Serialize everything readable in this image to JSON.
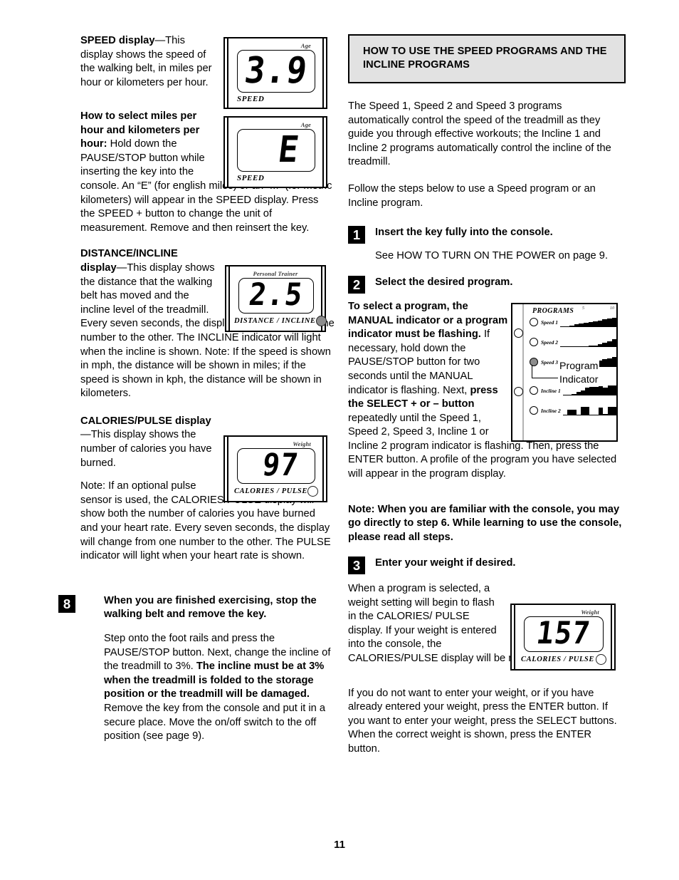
{
  "page": {
    "number": "11"
  },
  "left_column": {
    "speed_section": {
      "lead_bold": "SPEED display",
      "lead_rest": "—This display shows the speed of the walking belt, in miles per hour or kilometers per hour."
    },
    "units_section": {
      "lead_bold": "How to select miles per hour and kilometers per hour:",
      "lead_rest": " Hold down the PAUSE/STOP button while inserting the key into the console. An “E” (for english miles) or an “M” (for metric kilometers) will appear in the SPEED display. Press the SPEED + button to change the unit of measurement. Remove and then reinsert the key."
    },
    "distance_section": {
      "lead_bold": "DISTANCE/INCLINE display",
      "lead_rest": "—This display shows the distance that the walking belt has moved and the incline level of the treadmill. Every seven seconds, the display will change from one number to the other. The INCLINE indicator will light when the incline is shown. Note: If the speed is shown in mph, the distance will be shown in miles; if the speed is shown in kph, the distance will be shown in kilometers."
    },
    "calories_section": {
      "lead_bold": "CALORIES/PULSE display",
      "lead_rest": "—This display shows the number of calories you have burned."
    },
    "calories_note": "Note: If an optional pulse sensor is used, the CALORIES/PULSE display will show both the number of calories you have burned and your heart rate. Every seven seconds, the display will change from one number to the other. The PULSE indicator will light when your heart rate is shown.",
    "step8": {
      "number": "8",
      "title": "When you are finished exercising, stop the walking belt and remove the key.",
      "body_part1": "Step onto the foot rails and press the PAUSE/STOP button. Next, change the incline of the treadmill to 3%. ",
      "body_bold": "The incline must be at 3% when the treadmill is folded to the storage position or the treadmill will be damaged.",
      "body_part2": " Remove the key from the console and put it in a secure place. Move the on/off switch to the off position (see page 9)."
    },
    "displays": {
      "speed": {
        "top_label": "Age",
        "value": "3.9",
        "bottom_label": "SPEED"
      },
      "speed_units": {
        "top_label": "Age",
        "value": "E",
        "bottom_label": "SPEED"
      },
      "distance": {
        "top_label": "Personal Trainer",
        "value": "2.5",
        "bottom_label": "DISTANCE / INCLINE",
        "indicator": "filled-dot-icon"
      },
      "calories": {
        "top_label": "Weight",
        "value": "97",
        "bottom_label": "CALORIES / PULSE",
        "indicator": "open-dot-icon"
      }
    }
  },
  "right_column": {
    "heading": "HOW TO USE THE SPEED PROGRAMS AND THE INCLINE PROGRAMS",
    "intro_1": "The Speed 1, Speed 2 and Speed 3 programs automatically control the speed of the treadmill as they guide you through effective workouts; the Incline 1 and Incline 2 programs automatically control the incline of the treadmill.",
    "intro_2": "Follow the steps below to use a Speed program or an Incline program.",
    "step1": {
      "number": "1",
      "title": "Insert the key fully into the console.",
      "body": "See HOW TO TURN ON THE POWER on page 9."
    },
    "step2": {
      "number": "2",
      "title": "Select the desired program.",
      "body_bold_1": "To select a program, the MANUAL indicator or a program indicator must be flashing.",
      "body_plain_1": " If necessary, hold down the PAUSE/STOP button for two seconds until the MANUAL indicator is flashing. Next, ",
      "body_bold_2": "press the SELECT + or – button",
      "body_plain_2": " repeatedly until the Speed 1, Speed 2, Speed 3, Incline 1 or Incline 2 program indicator is flashing. Then, press the ENTER button. A profile of the program you have selected will appear in the program display.",
      "note": "Note: When you are familiar with the console, you may go directly to step 6. While learning to use the console, please read all steps."
    },
    "step3": {
      "number": "3",
      "title": "Enter your weight if desired.",
      "body_1": "When a program is selected, a weight setting will begin to flash in the CALORIES/ PULSE display. If your weight is entered into the console, the CALORIES/PULSE display will be more accurate.",
      "body_2": "If you do not want to enter your weight, or if you have already entered your weight, press the ENTER button. If you want to enter your weight, press the SELECT buttons. When the correct weight is shown, press the ENTER button."
    },
    "weight_display": {
      "top_label": "Weight",
      "value": "157",
      "bottom_label": "CALORIES / PULSE",
      "indicator": "open-dot-icon"
    },
    "programs_panel": {
      "title": "PROGRAMS",
      "scale_marks": [
        "5",
        "10"
      ],
      "callout_line1": "Program",
      "callout_line2": "Indicator",
      "rows": [
        {
          "label": "Speed 1",
          "state": "off",
          "profile": [
            1,
            1,
            2,
            3,
            4,
            5,
            6,
            7,
            8,
            9,
            10,
            11
          ]
        },
        {
          "label": "Speed 2",
          "state": "off",
          "profile": [
            1,
            1,
            1,
            1,
            1,
            1,
            2,
            2,
            3,
            5,
            7,
            9
          ]
        },
        {
          "label": "Speed 3",
          "state": "on",
          "profile": [
            1,
            2,
            2,
            3,
            4,
            4,
            6,
            7,
            8,
            9,
            10,
            12
          ]
        },
        {
          "label": "Incline 1",
          "state": "off",
          "profile": [
            1,
            1,
            2,
            4,
            6,
            9,
            10,
            10,
            11,
            9,
            12,
            12
          ]
        },
        {
          "label": "Incline 2",
          "state": "off",
          "profile": [
            1,
            7,
            7,
            1,
            10,
            10,
            1,
            1,
            9,
            2,
            10,
            10
          ]
        }
      ]
    }
  }
}
